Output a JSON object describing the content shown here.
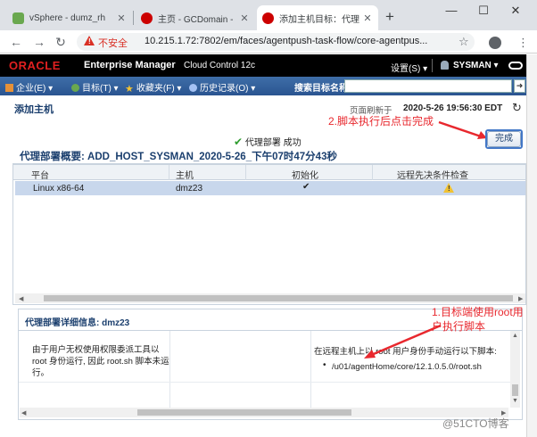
{
  "browser": {
    "tabs": [
      {
        "title": "vSphere - dumz_rh",
        "favicon_color": "#6aa84f"
      },
      {
        "title": "主页 - GCDomain -",
        "favicon_color": "#cc0000"
      },
      {
        "title": "添加主机目标：代理",
        "favicon_color": "#cc0000"
      }
    ],
    "new_tab": "+",
    "insecure_label": "不安全",
    "url": "10.215.1.72:7802/em/faces/agentpush-task-flow/core-agentpus..."
  },
  "em_header": {
    "logo": "ORACLE",
    "product": "Enterprise Manager",
    "edition": "Cloud Control 12c",
    "setup_menu": "设置(S) ▾",
    "user": "SYSMAN ▾"
  },
  "nav": {
    "items": [
      {
        "label": "企业(E) ▾",
        "icon_color": "#e69138"
      },
      {
        "label": "目标(T) ▾",
        "icon_color": "#6aa84f"
      },
      {
        "label": "收藏夹(F) ▾",
        "icon_color": "#f1c232"
      },
      {
        "label": "历史记录(O) ▾",
        "icon_color": "#a4c2f4"
      }
    ],
    "search_label": "搜索目标名称",
    "search_value": ""
  },
  "page": {
    "title": "添加主机",
    "refresh_label": "页面刷新于",
    "refresh_time": "2020-5-26 19:56:30 EDT",
    "done_button": "完成",
    "status_text": "代理部署 成功",
    "summary_title": "代理部署概要: ADD_HOST_SYSMAN_2020-5-26_下午07时47分43秒"
  },
  "table": {
    "columns": [
      "平台",
      "主机",
      "初始化",
      "远程先决条件检查"
    ],
    "rows": [
      {
        "platform": "Linux x86-64",
        "host": "dmz23",
        "init": "success",
        "prereq": "warning"
      }
    ]
  },
  "details": {
    "title": "代理部署详细信息: dmz23",
    "message": "由于用户无权使用权限委派工具以 root 身份运行, 因此 root.sh 脚本未运行。",
    "instruction": "在远程主机上以 root 用户身份手动运行以下脚本:",
    "script_path": "/u01/agentHome/core/12.1.0.5.0/root.sh"
  },
  "annotations": {
    "step1": "1.目标端使用root用户执行脚本",
    "step2": "2.脚本执行后点击完成",
    "color": "#e8282e"
  },
  "watermark": "@51CTO博客"
}
